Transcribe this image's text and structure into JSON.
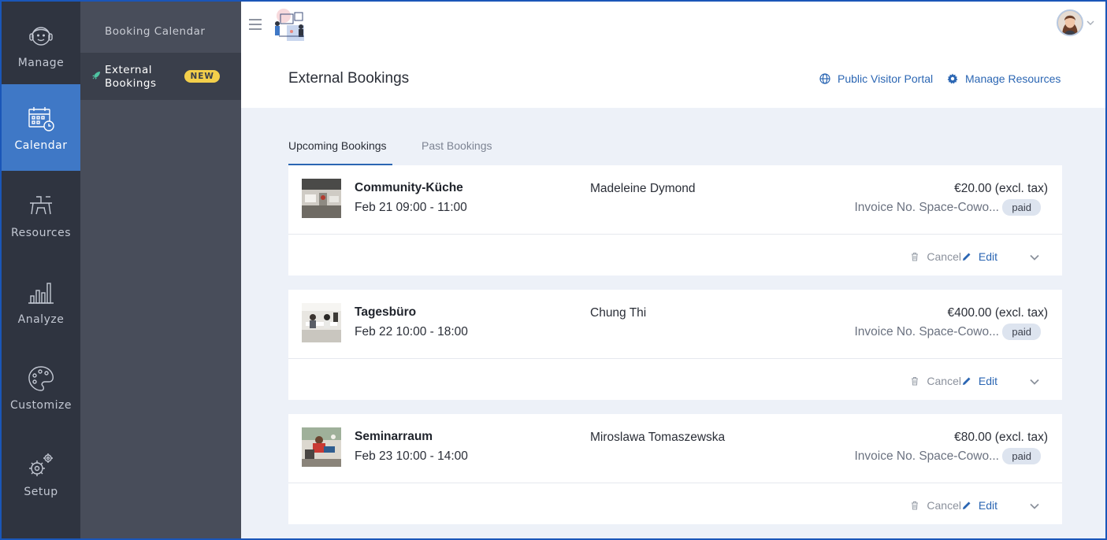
{
  "nav": {
    "items": [
      {
        "label": "Manage",
        "icon": "agent-icon"
      },
      {
        "label": "Calendar",
        "icon": "calendar-icon",
        "active": true
      },
      {
        "label": "Resources",
        "icon": "desk-chairs-icon"
      },
      {
        "label": "Analyze",
        "icon": "bar-chart-icon"
      },
      {
        "label": "Customize",
        "icon": "palette-icon"
      },
      {
        "label": "Setup",
        "icon": "gears-icon"
      }
    ]
  },
  "submenu": {
    "booking_calendar": "Booking Calendar",
    "external_line1": "External",
    "external_line2": "Bookings",
    "new_badge": "NEW"
  },
  "header": {
    "title": "External Bookings",
    "public_portal": "Public Visitor Portal",
    "manage_resources": "Manage Resources"
  },
  "tabs": {
    "upcoming": "Upcoming Bookings",
    "past": "Past Bookings"
  },
  "bookings": [
    {
      "resource": "Community-Küche",
      "time": "Feb 21 09:00 - 11:00",
      "visitor": "Madeleine Dymond",
      "price": "€20.00 (excl. tax)",
      "invoice": "Invoice No. Space-Cowo...",
      "status": "paid"
    },
    {
      "resource": "Tagesbüro",
      "time": "Feb 22 10:00 - 18:00",
      "visitor": "Chung Thi",
      "price": "€400.00 (excl. tax)",
      "invoice": "Invoice No. Space-Cowo...",
      "status": "paid"
    },
    {
      "resource": "Seminarraum",
      "time": "Feb 23 10:00 - 14:00",
      "visitor": "Miroslawa Tomaszewska",
      "price": "€80.00 (excl. tax)",
      "invoice": "Invoice No. Space-Cowo...",
      "status": "paid"
    }
  ],
  "actions": {
    "cancel": "Cancel",
    "edit": "Edit"
  },
  "colors": {
    "accent": "#3f78c6",
    "link": "#2b66b3",
    "rail_bg": "#2f3440",
    "submenu_bg": "#484d5a",
    "badge_new": "#f3cf4b"
  }
}
